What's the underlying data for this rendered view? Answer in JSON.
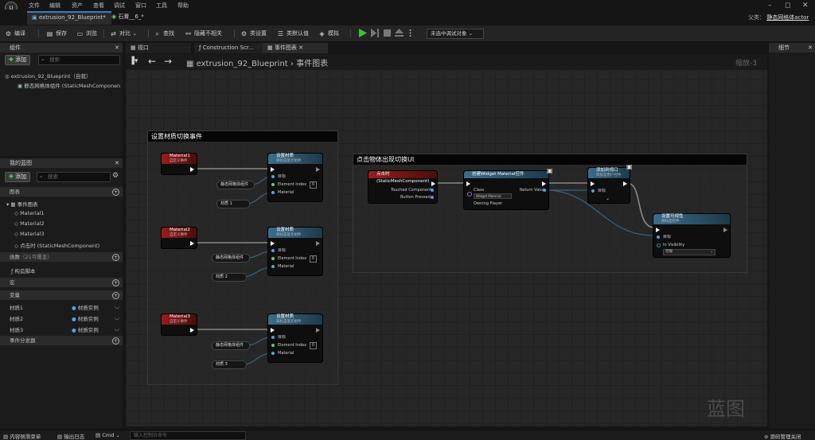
{
  "menubar": {
    "logo": "U",
    "items": [
      "文件",
      "编辑",
      "资产",
      "查看",
      "调试",
      "窗口",
      "工具",
      "帮助"
    ]
  },
  "tabs": [
    {
      "label": "extrusion_92_Blueprint*"
    },
    {
      "label": "石膏__6_*"
    }
  ],
  "parent_class": {
    "label": "父类：",
    "value": "静态网格体actor"
  },
  "toolbar": {
    "compile": "编译",
    "save": "保存",
    "browse": "浏览",
    "diff": "对比",
    "find": "查找",
    "hide_unrelated": "隐藏不相关",
    "class_settings": "类设置",
    "class_defaults": "类默认值",
    "simulate": "模拟",
    "debug_object": "未选中调试对象"
  },
  "components_panel": {
    "title": "组件",
    "add": "添加",
    "search_placeholder": "搜索",
    "root": "extrusion_92_Blueprint（自我）",
    "child": "静态网格体组件 (StaticMeshComponen"
  },
  "mybp_panel": {
    "title": "我的蓝图",
    "add": "添加",
    "search_placeholder": "搜索",
    "graphs_header": "图表",
    "event_graph": "事件图表",
    "events": [
      "Material1",
      "Material2",
      "Material3",
      "点击时 (StaticMeshComponent)"
    ],
    "functions_header": "函数",
    "functions_hint": "（21可覆盖）",
    "construction_script": "构造脚本",
    "macros_header": "宏",
    "variables_header": "变量",
    "variables": [
      {
        "name": "材质1",
        "type": "材质实例"
      },
      {
        "name": "材质2",
        "type": "材质实例"
      },
      {
        "name": "材质3",
        "type": "材质实例"
      }
    ],
    "dispatchers_header": "事件分发器"
  },
  "graph_tabs": [
    {
      "label": "视口"
    },
    {
      "label": "Construction Scr..."
    },
    {
      "label": "事件图表"
    }
  ],
  "graph_header": {
    "breadcrumb_bp": "extrusion_92_Blueprint",
    "breadcrumb_sep": "›",
    "breadcrumb_graph": "事件图表",
    "zoom": "缩放-3"
  },
  "comments": {
    "material_switch": "设置材质切换事件",
    "click_ui": "点击物体出现切换UI"
  },
  "nodes": {
    "custom_event_sub": "自定义事件",
    "events": [
      "Material1",
      "Material2",
      "Material3"
    ],
    "set_material": "设置材质",
    "set_material_sub": "目标是基元组件",
    "target": "目标",
    "element_index": "Element Index",
    "element_index_value": "0",
    "material": "Material",
    "mesh_comp": "静态网格体组件",
    "mat_vars": [
      "材质 1",
      "材质 2",
      "材质 3"
    ],
    "on_clicked": "点击时 (StaticMeshComponent)",
    "touched_component": "Touched Component",
    "button_pressed": "Button Pressed",
    "create_widget": "创建Widget Material控件",
    "class": "Class",
    "class_value": "Widget Material",
    "owning_player": "Owning Player",
    "return_value": "Return Value",
    "add_viewport": "添加到视口",
    "add_viewport_sub": "目标是用户控件",
    "set_visibility": "设置可视性",
    "set_visibility_sub": "目标是控件",
    "in_visibility": "In Visibility",
    "visibility_value": "可视"
  },
  "details_panel": {
    "title": "细节"
  },
  "watermark": "蓝图",
  "statusbar": {
    "content_drawer": "内容侧滑菜单",
    "output_log": "输出日志",
    "cmd": "Cmd",
    "console_placeholder": "输入控制台命令",
    "source_control": "源码管理关闭"
  }
}
